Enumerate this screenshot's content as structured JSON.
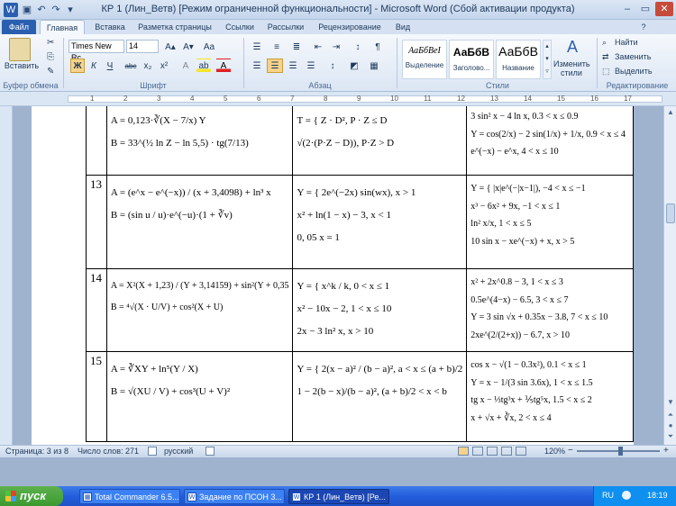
{
  "window": {
    "title": "КР 1 (Лин_Ветв) [Режим ограниченной функциональности]  -  Microsoft Word (Сбой активации продукта)"
  },
  "qat": {
    "save": "▣",
    "undo": "↶",
    "redo": "↷",
    "more": "▾"
  },
  "window_controls": {
    "minimize": "–",
    "maximize": "▭",
    "close": "✕",
    "help": "?"
  },
  "tabs": [
    "Файл",
    "Главная",
    "Вставка",
    "Разметка страницы",
    "Ссылки",
    "Рассылки",
    "Рецензирование",
    "Вид"
  ],
  "ribbon": {
    "clipboard": {
      "paste_label": "Вставить",
      "group": "Буфер обмена"
    },
    "font": {
      "name": "Times New Rc",
      "size": "14",
      "group": "Шрифт",
      "bold": "Ж",
      "italic": "К",
      "underline": "Ч",
      "strike": "abc",
      "sub": "x₂",
      "sup": "x²",
      "grow": "A▴",
      "shrink": "A▾",
      "aa": "Aa",
      "color": "A"
    },
    "paragraph": {
      "group": "Абзац",
      "pilcrow": "¶"
    },
    "styles": {
      "group": "Стили",
      "items": [
        {
          "sample": "АаБбВеI",
          "name": "Выделение"
        },
        {
          "sample": "АаБбВ",
          "name": "Заголово..."
        },
        {
          "sample": "АаБбВ",
          "name": "Название"
        }
      ],
      "change": "Изменить стили"
    },
    "editing": {
      "group": "Редактирование",
      "find": "Найти",
      "replace": "Заменить",
      "select": "Выделить"
    }
  },
  "ruler": {
    "numbers": [
      "1",
      "2",
      "3",
      "4",
      "5",
      "6",
      "7",
      "8",
      "9",
      "10",
      "11",
      "12",
      "13",
      "14",
      "15",
      "16",
      "17"
    ]
  },
  "table": {
    "rows": [
      {
        "num": "",
        "c1": [
          "A = 0,123·∛(X − 7/x) Y",
          "B = 33^(½ ln Z − ln 5,5) · tg(7/13)"
        ],
        "c2": [
          "T = { Z · D²,   P · Z ≤ D",
          "      √(2·(P·Z − D)),   P·Z > D"
        ],
        "c3": [
          "3 sin² x − 4 ln x,   0.3 < x ≤ 0.9",
          "Y = cos(2/x) − 2 sin(1/x) + 1/x,   0.9 < x ≤ 4",
          "e^(−x) − e^x,   4 < x ≤ 10"
        ]
      },
      {
        "num": "13",
        "c1": [
          "A = (e^x − e^(−x)) / (x + 3,4098) + ln³ x",
          "B = (sin u / u)·e^(−u)·(1 + ∛v)"
        ],
        "c2": [
          "Y = { 2e^(−2x) sin(wx),   x > 1",
          "      x² + ln(1 − x) − 3,  x < 1",
          "      0, 05          x = 1"
        ],
        "c3": [
          "Y = { |x|e^(−|x−1|),  −4 < x ≤ −1",
          "      x³ − 6x² + 9x,  −1 < x ≤ 1",
          "      ln² x/x,  1 < x ≤ 5",
          "      10 sin x − xe^(−x) + x,  x > 5"
        ]
      },
      {
        "num": "14",
        "c1": [
          "A = X²(X + 1,23) / (Y + 3,14159) + sin²(Y + 0,35",
          "B = ⁴√(X · U/V) + cos²(X + U)"
        ],
        "c2": [
          "Y = { x^k / k,          0 < x ≤ 1",
          "      x² − 10x − 2,  1 < x ≤ 10",
          "      2x − 3 ln² x,  x > 10"
        ],
        "c3": [
          "x² + 2x^0.8 − 3,   1 < x ≤ 3",
          "0.5e^(4−x) − 6.5,   3 < x ≤ 7",
          "Y = 3 sin √x + 0.35x − 3.8,   7 < x ≤ 10",
          "2xe^(2/(2+x)) − 6.7,   x > 10"
        ]
      },
      {
        "num": "15",
        "c1": [
          "A = ∛XY + ln⁵(Y / X)",
          "B = √(XU / V) + cos³(U + V)²"
        ],
        "c2": [
          "Y = { 2(x − a)² / (b − a)²,   a < x ≤ (a + b)/2",
          "      1 − 2(b − x)/(b − a)²,  (a + b)/2 < x < b"
        ],
        "c3": [
          "cos x − √(1 − 0.3x²),   0.1 < x ≤ 1",
          "Y = x − 1/(3 sin 3.6x),   1 < x ≤ 1.5",
          "tg x − ⅓tg³x + ⅕tg⁵x,   1.5 < x ≤ 2",
          "x + √x + ∛x,   2 < x ≤ 4"
        ]
      }
    ]
  },
  "status": {
    "page": "Страница: 3 из 8",
    "words": "Число слов: 271",
    "lang": "русский",
    "zoom": "120%",
    "zoom_minus": "−",
    "zoom_plus": "+"
  },
  "taskbar": {
    "start": "пуск",
    "tasks": [
      "Total Commander 6.5...",
      "Задание по ПСОН 3...",
      "КР 1 (Лин_Ветв) [Ре..."
    ],
    "lang": "RU",
    "time": "18:19"
  }
}
